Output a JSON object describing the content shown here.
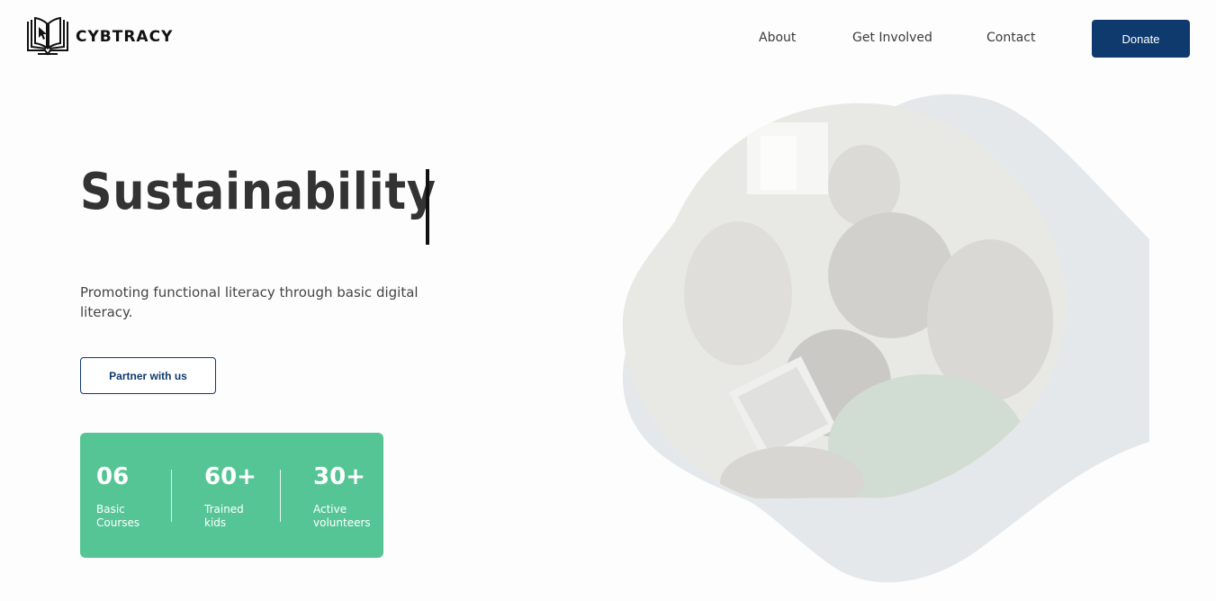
{
  "brand": {
    "name": "CYBTRACY",
    "logo_icon": "open-book-cursor-icon"
  },
  "nav": {
    "items": [
      "About",
      "Get Involved",
      "Contact"
    ],
    "donate_label": "Donate"
  },
  "colors": {
    "primary": "#0f3a6e",
    "accent": "#56c596",
    "blob": "#e5e8eb"
  },
  "hero": {
    "title": "Sustainability",
    "subtitle": "Promoting functional literacy through basic digital literacy.",
    "partner_label": "Partner with us"
  },
  "stats": [
    {
      "value": "06",
      "label": "Basic Courses"
    },
    {
      "value": "60+",
      "label": "Trained kids"
    },
    {
      "value": "30+",
      "label": "Active volunteers"
    }
  ]
}
